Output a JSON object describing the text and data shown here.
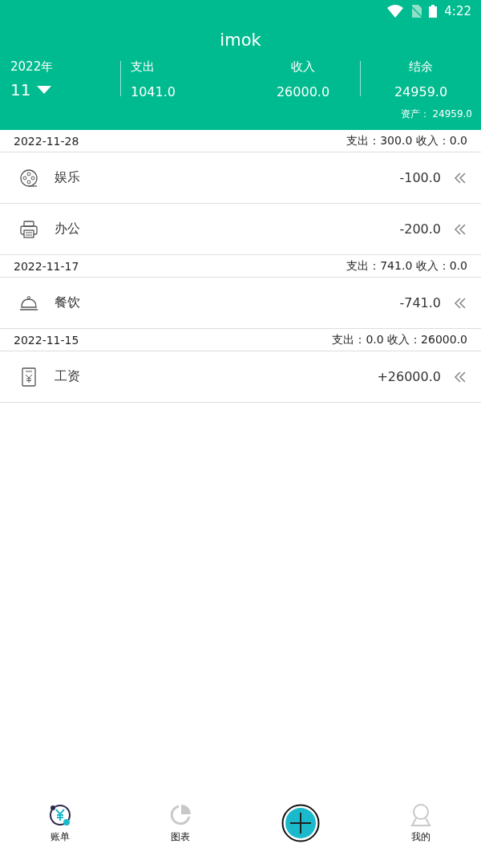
{
  "status_bar": {
    "time": "4:22"
  },
  "title": "imok",
  "summary": {
    "year": "2022年",
    "month": "11",
    "expense_label": "支出",
    "expense": "1041.0",
    "income_label": "收入",
    "income": "26000.0",
    "balance_label": "结余",
    "balance": "24959.0",
    "assets": "资产：  24959.0"
  },
  "days": [
    {
      "date": "2022-11-28",
      "totals": "支出：300.0 收入：0.0",
      "entries": [
        {
          "kind": "film",
          "category": "娱乐",
          "amount": "-100.0"
        },
        {
          "kind": "printer",
          "category": "办公",
          "amount": "-200.0"
        }
      ]
    },
    {
      "date": "2022-11-17",
      "totals": "支出：741.0 收入：0.0",
      "entries": [
        {
          "kind": "food",
          "category": "餐饮",
          "amount": "-741.0"
        }
      ]
    },
    {
      "date": "2022-11-15",
      "totals": "支出：0.0 收入：26000.0",
      "entries": [
        {
          "kind": "salary",
          "category": "工资",
          "amount": "+26000.0"
        }
      ]
    }
  ],
  "nav": [
    {
      "kind": "bill",
      "label": "账单",
      "selected": true
    },
    {
      "kind": "chart",
      "label": "图表",
      "selected": false
    },
    {
      "kind": "add",
      "selected": false
    },
    {
      "kind": "profile",
      "label": "我的",
      "selected": false
    }
  ]
}
